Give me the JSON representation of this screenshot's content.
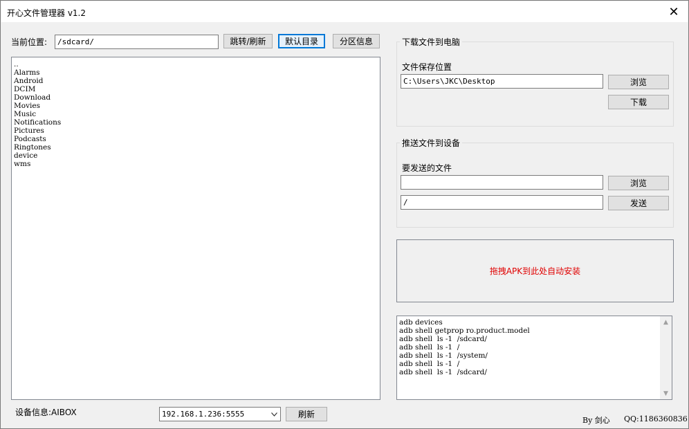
{
  "window": {
    "title": "开心文件管理器  v1.2",
    "close_glyph": "✕"
  },
  "location": {
    "label": "当前位置:",
    "path": "/sdcard/",
    "goto_button": "跳转/刷新",
    "default_dir_button": "默认目录",
    "partition_button": "分区信息"
  },
  "file_list": {
    "items": [
      "..",
      "Alarms",
      "Android",
      "DCIM",
      "Download",
      "Movies",
      "Music",
      "Notifications",
      "Pictures",
      "Podcasts",
      "Ringtones",
      "device",
      "wms"
    ]
  },
  "download": {
    "group_title": "下载文件到电脑",
    "save_location_label": "文件保存位置",
    "save_path": "C:\\Users\\JKC\\Desktop",
    "browse_button": "浏览",
    "download_button": "下载"
  },
  "push": {
    "group_title": "推送文件到设备",
    "file_label": "要发送的文件",
    "file_path": "",
    "target_path": "/",
    "browse_button": "浏览",
    "send_button": "发送"
  },
  "drop_zone": {
    "text": "拖拽APK到此处自动安装",
    "color": "#e00000"
  },
  "log": {
    "lines": [
      "adb devices",
      "adb shell getprop ro.product.model",
      "adb shell  ls -1  /sdcard/",
      "adb shell  ls -1  /",
      "adb shell  ls -1  /system/",
      "adb shell  ls -1  /",
      "adb shell  ls -1  /sdcard/"
    ]
  },
  "device": {
    "info_label": "设备信息:AIBOX",
    "address": "192.168.1.236:5555",
    "refresh_button": "刷新"
  },
  "footer": {
    "author": "By 剑心",
    "qq": "QQ:1186360836"
  },
  "colors": {
    "accent": "#0078d7",
    "window_bg": "#f0f0f0"
  }
}
